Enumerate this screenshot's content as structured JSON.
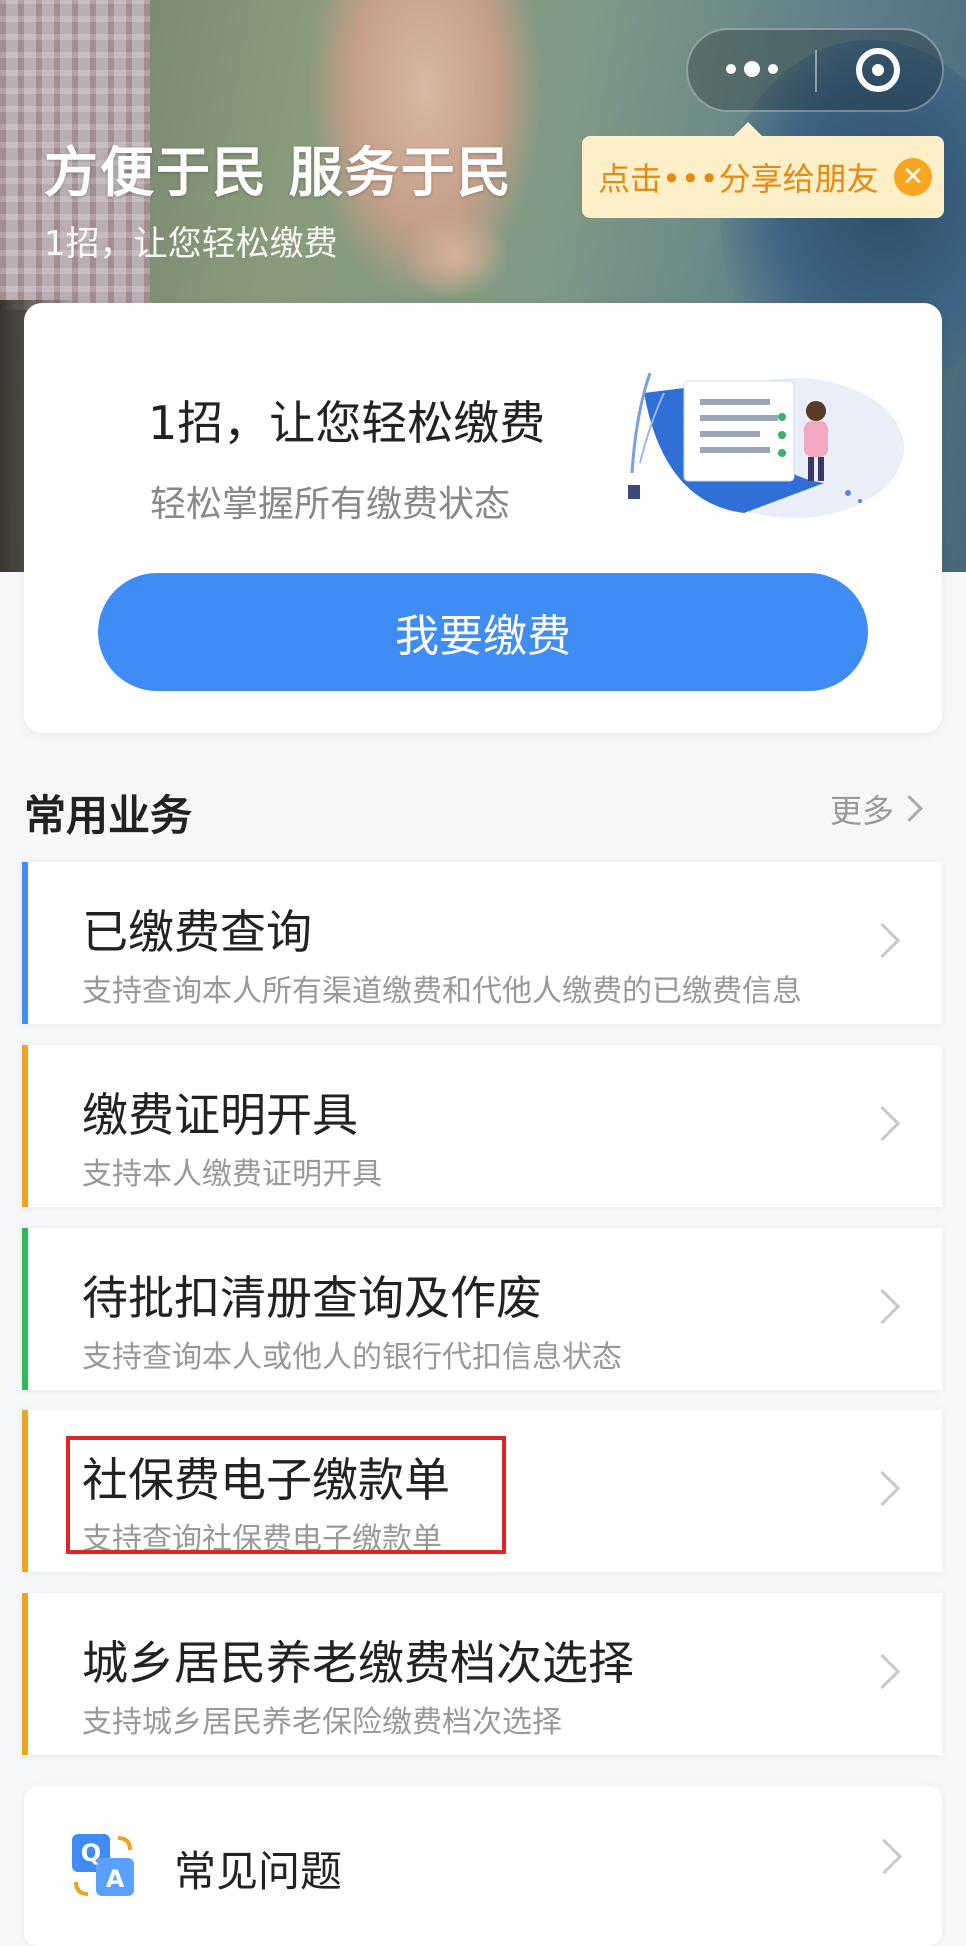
{
  "hero": {
    "title": "方便于民 服务于民",
    "subtitle": "1招，让您轻松缴费"
  },
  "capsule": {
    "more_icon": "more-dots-icon",
    "close_icon": "close-miniprogram-icon"
  },
  "share_tip": {
    "text": "点击•••分享给朋友",
    "close_icon": "close-icon",
    "close_glyph": "✕"
  },
  "card": {
    "title": "1招，让您轻松缴费",
    "subtitle": "轻松掌握所有缴费状态",
    "button_label": "我要缴费",
    "button_color": "#3f8cf4"
  },
  "section": {
    "title": "常用业务",
    "more_label": "更多"
  },
  "services": [
    {
      "name": "已缴费查询",
      "desc": "支持查询本人所有渠道缴费和代他人缴费的已缴费信息",
      "accent": "#3f8cf4"
    },
    {
      "name": "缴费证明开具",
      "desc": "支持本人缴费证明开具",
      "accent": "#f0a31c"
    },
    {
      "name": "待批扣清册查询及作废",
      "desc": "支持查询本人或他人的银行代扣信息状态",
      "accent": "#2dbb5a"
    },
    {
      "name": "社保费电子缴款单",
      "desc": "支持查询社保费电子缴款单",
      "accent": "#f0a31c",
      "highlighted": true
    },
    {
      "name": "城乡居民养老缴费档次选择",
      "desc": "支持城乡居民养老保险缴费档次选择",
      "accent": "#f0a31c"
    }
  ],
  "faq": {
    "label": "常见问题",
    "icon": "qa-icon",
    "icon_q": "Q",
    "icon_a": "A"
  }
}
